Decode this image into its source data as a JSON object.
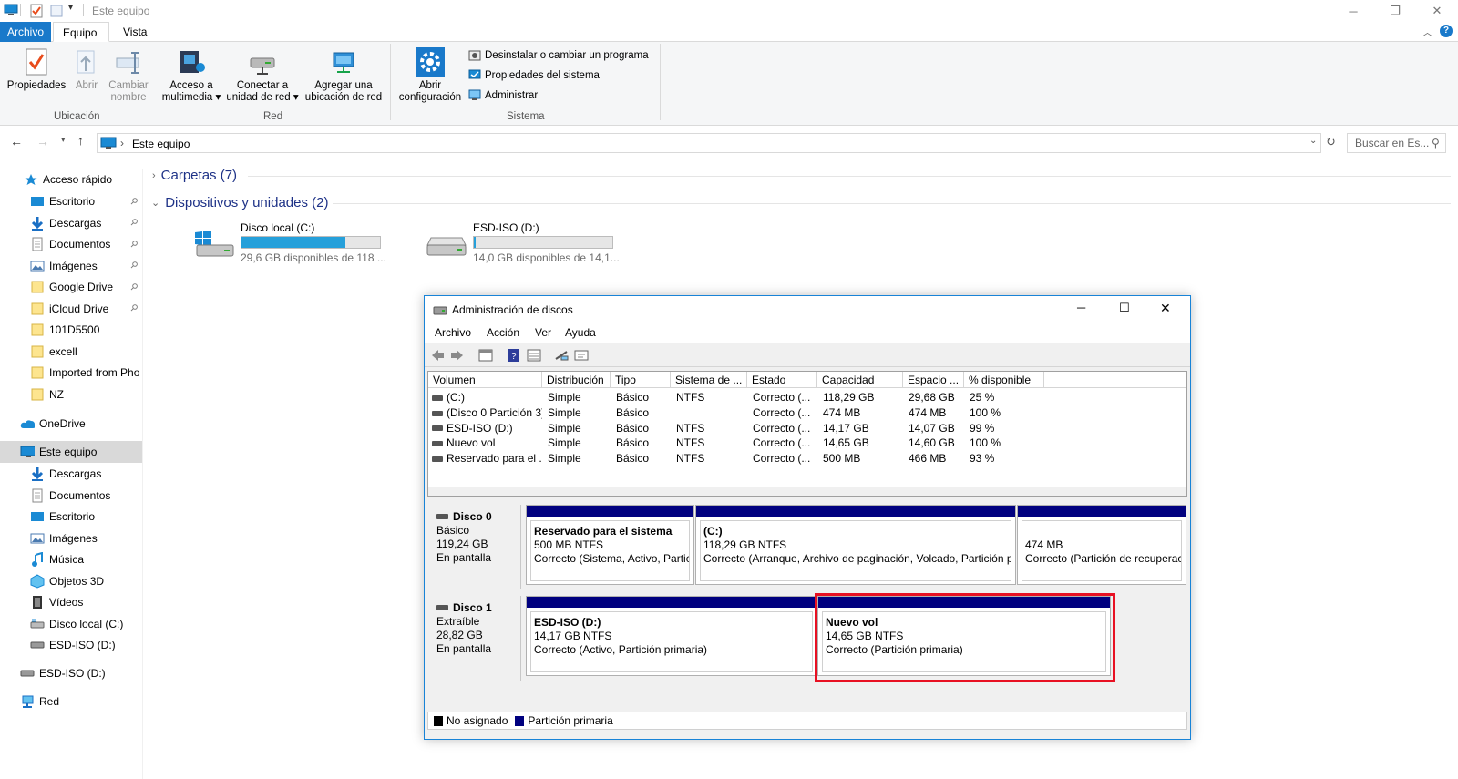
{
  "window": {
    "title": "Este equipo"
  },
  "ribbon_tabs": [
    "Archivo",
    "Equipo",
    "Vista"
  ],
  "ribbon": {
    "ubicacion": {
      "label": "Ubicación",
      "buttons": [
        {
          "label1": "Propiedades",
          "label2": ""
        },
        {
          "label1": "Abrir",
          "label2": ""
        },
        {
          "label1": "Cambiar",
          "label2": "nombre"
        }
      ]
    },
    "red": {
      "label": "Red",
      "buttons": [
        {
          "label1": "Acceso a",
          "label2": "multimedia ▾"
        },
        {
          "label1": "Conectar a",
          "label2": "unidad de red ▾"
        },
        {
          "label1": "Agregar una",
          "label2": "ubicación de red"
        }
      ]
    },
    "sistema": {
      "label": "Sistema",
      "open_config": {
        "label1": "Abrir",
        "label2": "configuración"
      },
      "items": [
        "Desinstalar o cambiar un programa",
        "Propiedades del sistema",
        "Administrar"
      ]
    }
  },
  "address": {
    "path": "Este equipo",
    "search_placeholder": "Buscar en Es..."
  },
  "nav": {
    "quick_access": "Acceso rápido",
    "quick_items": [
      "Escritorio",
      "Descargas",
      "Documentos",
      "Imágenes",
      "Google Drive",
      "iCloud Drive",
      "101D5500",
      "excell",
      "Imported from Pho",
      "NZ"
    ],
    "onedrive": "OneDrive",
    "this_pc": "Este equipo",
    "pc_items": [
      "Descargas",
      "Documentos",
      "Escritorio",
      "Imágenes",
      "Música",
      "Objetos 3D",
      "Vídeos",
      "Disco local (C:)",
      "ESD-ISO (D:)"
    ],
    "esd": "ESD-ISO (D:)",
    "network": "Red"
  },
  "content": {
    "folders_header": "Carpetas (7)",
    "devices_header": "Dispositivos y unidades (2)",
    "drives": [
      {
        "name": "Disco local (C:)",
        "free": "29,6 GB disponibles de 118 ...",
        "used_fraction": 0.75
      },
      {
        "name": "ESD-ISO (D:)",
        "free": "14,0 GB disponibles de 14,1...",
        "used_fraction": 0.01
      }
    ]
  },
  "disk_mgmt": {
    "title": "Administración de discos",
    "menu": [
      "Archivo",
      "Acción",
      "Ver",
      "Ayuda"
    ],
    "columns": [
      "Volumen",
      "Distribución",
      "Tipo",
      "Sistema de ...",
      "Estado",
      "Capacidad",
      "Espacio ...",
      "% disponible"
    ],
    "rows": [
      [
        "(C:)",
        "Simple",
        "Básico",
        "NTFS",
        "Correcto (...",
        "118,29 GB",
        "29,68 GB",
        "25 %"
      ],
      [
        "(Disco 0 Partición 3)",
        "Simple",
        "Básico",
        "",
        "Correcto (...",
        "474 MB",
        "474 MB",
        "100 %"
      ],
      [
        "ESD-ISO (D:)",
        "Simple",
        "Básico",
        "NTFS",
        "Correcto (...",
        "14,17 GB",
        "14,07 GB",
        "99 %"
      ],
      [
        "Nuevo vol",
        "Simple",
        "Básico",
        "NTFS",
        "Correcto (...",
        "14,65 GB",
        "14,60 GB",
        "100 %"
      ],
      [
        "Reservado para el ...",
        "Simple",
        "Básico",
        "NTFS",
        "Correcto (...",
        "500 MB",
        "466 MB",
        "93 %"
      ]
    ],
    "disks": [
      {
        "name": "Disco 0",
        "type": "Básico",
        "size": "119,24 GB",
        "state": "En pantalla",
        "partitions": [
          {
            "title": "Reservado para el sistema",
            "fs": "500 MB NTFS",
            "status": "Correcto (Sistema, Activo, Partici"
          },
          {
            "title": "(C:)",
            "fs": "118,29 GB NTFS",
            "status": "Correcto (Arranque, Archivo de paginación, Volcado, Partición p"
          },
          {
            "title": "",
            "fs": "474 MB",
            "status": "Correcto (Partición de recuperac"
          }
        ]
      },
      {
        "name": "Disco 1",
        "type": "Extraíble",
        "size": "28,82 GB",
        "state": "En pantalla",
        "partitions": [
          {
            "title": "ESD-ISO  (D:)",
            "fs": "14,17 GB NTFS",
            "status": "Correcto (Activo, Partición primaria)"
          },
          {
            "title": "Nuevo vol",
            "fs": "14,65 GB NTFS",
            "status": "Correcto (Partición primaria)"
          }
        ]
      }
    ],
    "legend": [
      "No asignado",
      "Partición primaria"
    ]
  },
  "colors": {
    "accent": "#1979ca",
    "partition_bar": "#00007f",
    "highlight": "#e81123",
    "drive_bar": "#26a0da"
  }
}
